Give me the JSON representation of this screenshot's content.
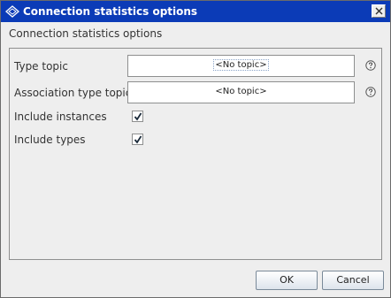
{
  "window": {
    "title": "Connection statistics options",
    "close_icon": "close-icon",
    "app_icon": "diamond-icon"
  },
  "dialog": {
    "header": "Connection statistics options",
    "fields": {
      "type_topic": {
        "label": "Type topic",
        "value": "<No topic>"
      },
      "association_type_topic": {
        "label": "Association type topic",
        "value": "<No topic>"
      },
      "include_instances": {
        "label": "Include instances",
        "checked": true
      },
      "include_types": {
        "label": "Include types",
        "checked": true
      }
    },
    "help_icon": "help-icon"
  },
  "buttons": {
    "ok": "OK",
    "cancel": "Cancel"
  },
  "colors": {
    "titlebar": "#0b3bb7",
    "background": "#eeeeee"
  }
}
